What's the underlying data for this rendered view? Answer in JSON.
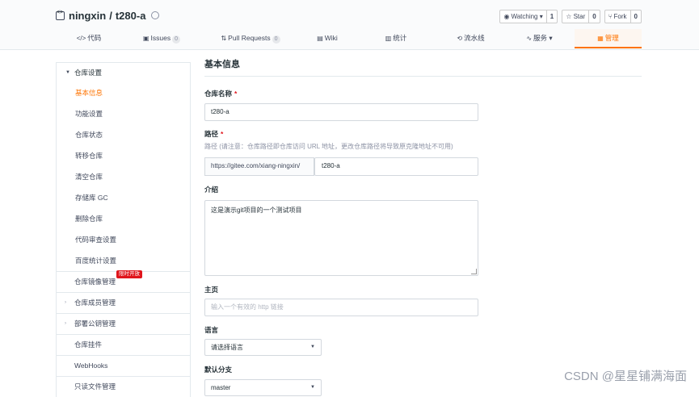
{
  "repo": {
    "owner": "ningxin",
    "separator": "/",
    "name": "t280-a"
  },
  "actions": [
    {
      "label": "Watching ▾",
      "count": "1"
    },
    {
      "label": "☆ Star",
      "count": "0"
    },
    {
      "label": "Fork",
      "count": "0"
    }
  ],
  "tabs": [
    {
      "icon": "</>",
      "label": "代码",
      "badge": ""
    },
    {
      "icon": "▣",
      "label": "Issues",
      "badge": "0"
    },
    {
      "icon": "⇅",
      "label": "Pull Requests",
      "badge": "0"
    },
    {
      "icon": "▤",
      "label": "Wiki",
      "badge": ""
    },
    {
      "icon": "▥",
      "label": "统计",
      "badge": ""
    },
    {
      "icon": "⟲",
      "label": "流水线",
      "badge": ""
    },
    {
      "icon": "∿",
      "label": "服务 ▾",
      "badge": ""
    },
    {
      "icon": "▦",
      "label": "管理",
      "badge": ""
    }
  ],
  "sidebar": {
    "group_title": "仓库设置",
    "items": [
      "基本信息",
      "功能设置",
      "仓库状态",
      "转移仓库",
      "清空仓库",
      "存储库 GC",
      "删除仓库",
      "代码审查设置",
      "百度统计设置"
    ],
    "rows": [
      {
        "label": "仓库镜像管理",
        "badge": "限时开放",
        "caret": ""
      },
      {
        "label": "仓库成员管理",
        "badge": "",
        "caret": "›"
      },
      {
        "label": "部署公钥管理",
        "badge": "",
        "caret": "›"
      },
      {
        "label": "仓库挂件",
        "badge": "",
        "caret": ""
      },
      {
        "label": "WebHooks",
        "badge": "",
        "caret": ""
      },
      {
        "label": "只读文件管理",
        "badge": "",
        "caret": ""
      }
    ]
  },
  "form": {
    "section_title": "基本信息",
    "name_label": "仓库名称",
    "name_value": "t280-a",
    "path_label": "路径",
    "path_hint": "路径 (请注意：仓库路径即仓库访问 URL 地址，更改仓库路径将导致原克隆地址不可用)",
    "path_prefix": "https://gitee.com/xiang-ningxin/",
    "path_value": "t280-a",
    "desc_label": "介绍",
    "desc_value": "这是演示git项目的一个测试项目",
    "homepage_label": "主页",
    "homepage_placeholder": "输入一个有效的 http 链接",
    "language_label": "语言",
    "language_value": "请选择语言",
    "branch_label": "默认分支",
    "branch_value": "master",
    "required_mark": "*"
  },
  "watermark": "CSDN @星星铺满海面"
}
